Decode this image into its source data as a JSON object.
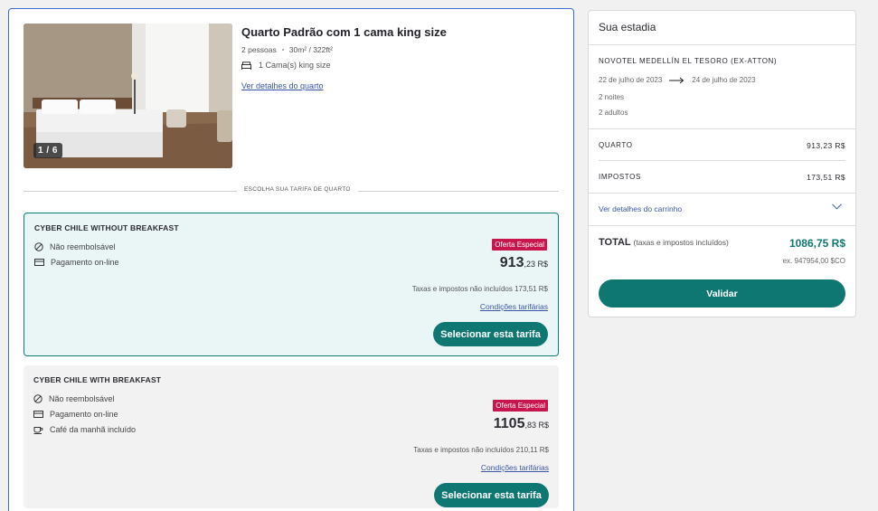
{
  "room": {
    "photo_counter": "1 / 6",
    "title": "Quarto Padrão com 1 cama king size",
    "guests": "2 pessoas",
    "area": "30m² / 322ft²",
    "bed": "1 Cama(s) king size",
    "details_link": "Ver detalhes do quarto"
  },
  "divider_label": "ESCOLHA SUA TARIFA DE QUARTO",
  "rates": [
    {
      "name": "CYBER CHILE WITHOUT BREAKFAST",
      "features": [
        "Não reembolsável",
        "Pagamento on-line"
      ],
      "badge": "Oferta Especial",
      "price_main": "913",
      "price_cents": ",23 R$",
      "taxes": "Taxas e impostos não incluídos 173,51 R$",
      "conditions": "Condições tarifárias",
      "button": "Selecionar esta tarifa"
    },
    {
      "name": "CYBER CHILE WITH BREAKFAST",
      "features": [
        "Não reembolsável",
        "Pagamento on-line",
        "Café da manhã incluído"
      ],
      "badge": "Oferta Especial",
      "price_main": "1105",
      "price_cents": ",83 R$",
      "taxes": "Taxas e impostos não incluídos 210,11 R$",
      "conditions": "Condições tarifárias",
      "button": "Selecionar esta tarifa"
    }
  ],
  "stay": {
    "title": "Sua estadia",
    "hotel": "NOVOTEL MEDELLÍN EL TESORO (EX-ATTON)",
    "checkin": "22 de julho de 2023",
    "checkout": "24 de julho de 2023",
    "nights": "2 noites",
    "adults": "2 adultos",
    "room_label": "QUARTO",
    "room_value": "913,23 R$",
    "taxes_label": "IMPOSTOS",
    "taxes_value": "173,51 R$",
    "cart_link": "Ver detalhes do carrinho",
    "total_label": "TOTAL",
    "total_note": "(taxas e impostos incluídos)",
    "total_value": "1086,75 R$",
    "total_ex": "ex. 947954,00 $CO",
    "validate": "Validar"
  },
  "colors": {
    "accent": "#0f7772",
    "offer": "#c8154e",
    "link": "#3a56a6",
    "selected_border": "#0d7c77"
  }
}
